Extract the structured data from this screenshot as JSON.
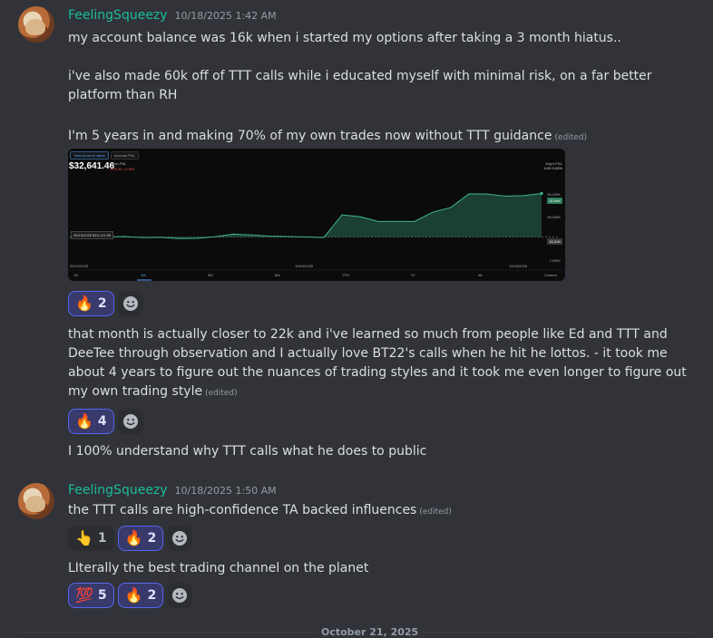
{
  "messages": [
    {
      "username": "FeelingSqueezy",
      "timestamp": "10/18/2025 1:42 AM",
      "lines": [
        "my account balance was 16k when i started my options after taking a 3 month hiatus..",
        "i've also made 60k off of TTT calls while i educated myself with minimal risk, on a far better platform than RH",
        "I'm 5 years in and making 70% of my own trades now without TTT guidance"
      ],
      "edited_label": "(edited)",
      "reactions_1": [
        {
          "emoji": "🔥",
          "count": "2"
        }
      ],
      "followup_1": "that month is actually closer to 22k and i've learned so much from people like Ed and TTT and DeeTee through observation and I actually love BT22's calls when he hit he lottos. - it took me about 4 years to figure out the nuances of trading styles and it took me even longer to figure out my own trading style",
      "reactions_2": [
        {
          "emoji": "🔥",
          "count": "4"
        }
      ],
      "followup_2": "I 100% understand why TTT calls what he does to public"
    },
    {
      "username": "FeelingSqueezy",
      "timestamp": "10/18/2025 1:50 AM",
      "line_1": "the TTT calls are high-confidence TA backed influences",
      "reactions_1": [
        {
          "emoji": "👆",
          "count": "1"
        },
        {
          "emoji": "🔥",
          "count": "2"
        }
      ],
      "line_2": "LIterally the best trading channel on the planet",
      "reactions_2": [
        {
          "emoji": "💯",
          "count": "5"
        },
        {
          "emoji": "🔥",
          "count": "2"
        }
      ]
    }
  ],
  "divider_text": "October 21, 2025",
  "chart_data": {
    "type": "area",
    "tabs": [
      "Total Account Value",
      "Account P&L"
    ],
    "title": "$32,641.46",
    "open_pnl_label": "Open P&L",
    "open_pnl_value": "-$75.36 -1.09%",
    "days_pnl_label": "Day's P&L",
    "days_pnl_value": "0.00 0.00%",
    "baseline_label": "09/19/2025",
    "baseline_value": "$16,124.59",
    "x_dates": [
      "09/19/2025",
      "10/04/2025",
      "10/18/2025"
    ],
    "time_ranges": [
      "1D",
      "1M",
      "3M",
      "6M",
      "YTD",
      "1Y",
      "All",
      "Custom"
    ],
    "active_range": "1M",
    "y_ticks": [
      "35,200K",
      "28,000K",
      "7,000K"
    ],
    "y_tags": [
      "32,64K",
      "16,31K"
    ],
    "values": [
      16.1,
      16.0,
      16.1,
      16.3,
      15.9,
      16.0,
      15.5,
      15.6,
      16.2,
      17.2,
      16.9,
      16.4,
      16.3,
      16.1,
      15.9,
      24.5,
      23.8,
      22.0,
      22.0,
      22.0,
      25.5,
      27.3,
      32.5,
      32.4,
      31.6,
      31.8,
      32.6
    ],
    "ylim": [
      7,
      40
    ],
    "colors": {
      "line": "#3fb68b",
      "fill": "#1f4d3d",
      "baseline": "#8a8a8a"
    }
  }
}
